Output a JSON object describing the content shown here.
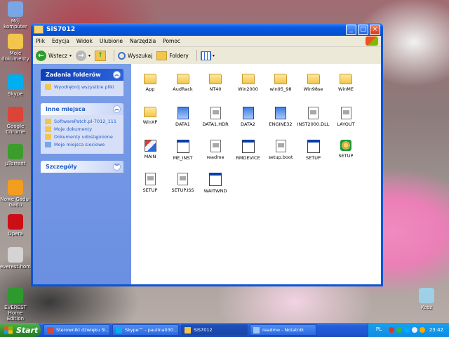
{
  "desktop": {
    "icons": [
      {
        "label": "Mój komputer",
        "icon": "computer-icon",
        "color": "#7aa6e6"
      },
      {
        "label": "Moje dokumenty",
        "icon": "documents-folder-icon",
        "color": "#f2c64c"
      },
      {
        "label": "Skype",
        "icon": "skype-icon",
        "color": "#00aff0"
      },
      {
        "label": "Google Chrome",
        "icon": "chrome-icon",
        "color": "#db4437"
      },
      {
        "label": "µTorrent",
        "icon": "utorrent-icon",
        "color": "#3d9d2c"
      },
      {
        "label": "Nowe Gadu-Gadu",
        "icon": "gadu-gadu-icon",
        "color": "#f29d1f"
      },
      {
        "label": "Opera",
        "icon": "opera-icon",
        "color": "#cc0f16"
      },
      {
        "label": "everest.hom...",
        "icon": "shortcut-icon",
        "color": "#d4d4d4"
      },
      {
        "label": "EVEREST Home Edition",
        "icon": "everest-icon",
        "color": "#2d9a2d"
      },
      {
        "label": "Kosz",
        "icon": "recycle-bin-icon",
        "color": "#9fd0e8"
      }
    ]
  },
  "window": {
    "title": "SiS7012",
    "menu": [
      "Plik",
      "Edycja",
      "Widok",
      "Ulubione",
      "Narzędzia",
      "Pomoc"
    ],
    "toolbar": {
      "back": "Wstecz",
      "search": "Wyszukaj",
      "folders": "Foldery"
    },
    "panels": {
      "tasks_title": "Zadania folderów",
      "tasks": [
        "Wyodrębnij wszystkie pliki"
      ],
      "places_title": "Inne miejsca",
      "places": [
        "SoftwarePatch.pl-7012_111",
        "Moje dokumenty",
        "Dokumenty udostępnione",
        "Moje miejsca sieciowe"
      ],
      "details_title": "Szczegóły"
    },
    "files": [
      {
        "name": "App",
        "type": "folder"
      },
      {
        "name": "AudRack",
        "type": "folder"
      },
      {
        "name": "NT40",
        "type": "folder"
      },
      {
        "name": "Win2000",
        "type": "folder"
      },
      {
        "name": "win95_98",
        "type": "folder"
      },
      {
        "name": "Win98se",
        "type": "folder"
      },
      {
        "name": "WinME",
        "type": "folder"
      },
      {
        "name": "WinXP",
        "type": "folder"
      },
      {
        "name": "DATA1",
        "type": "setup"
      },
      {
        "name": "DATA1.HDR",
        "type": "doc"
      },
      {
        "name": "DATA2",
        "type": "setup"
      },
      {
        "name": "ENGINE32",
        "type": "setup"
      },
      {
        "name": "INST2000.DLL",
        "type": "doc"
      },
      {
        "name": "LAYOUT",
        "type": "doc"
      },
      {
        "name": "MAIN",
        "type": "paint"
      },
      {
        "name": "ME_INST",
        "type": "appwin"
      },
      {
        "name": "readme",
        "type": "doc"
      },
      {
        "name": "RMDEVICE",
        "type": "appwin"
      },
      {
        "name": "setup.boot",
        "type": "doc"
      },
      {
        "name": "SETUP",
        "type": "appwin"
      },
      {
        "name": "SETUP",
        "type": "gear"
      },
      {
        "name": "SETUP",
        "type": "doc"
      },
      {
        "name": "SETUP.ISS",
        "type": "doc"
      },
      {
        "name": "WAITWND",
        "type": "appwin"
      }
    ]
  },
  "taskbar": {
    "start": "Start",
    "tasks": [
      {
        "label": "Sterowniki dźwięku SI...",
        "icon": "chrome-icon",
        "active": false
      },
      {
        "label": "Skype™ - paulina030...",
        "icon": "skype-icon",
        "active": false
      },
      {
        "label": "SiS7012",
        "icon": "folder-icon",
        "active": true
      },
      {
        "label": "readme - Notatnik",
        "icon": "notepad-icon",
        "active": false
      }
    ],
    "lang": "PL",
    "clock": "23:42"
  }
}
